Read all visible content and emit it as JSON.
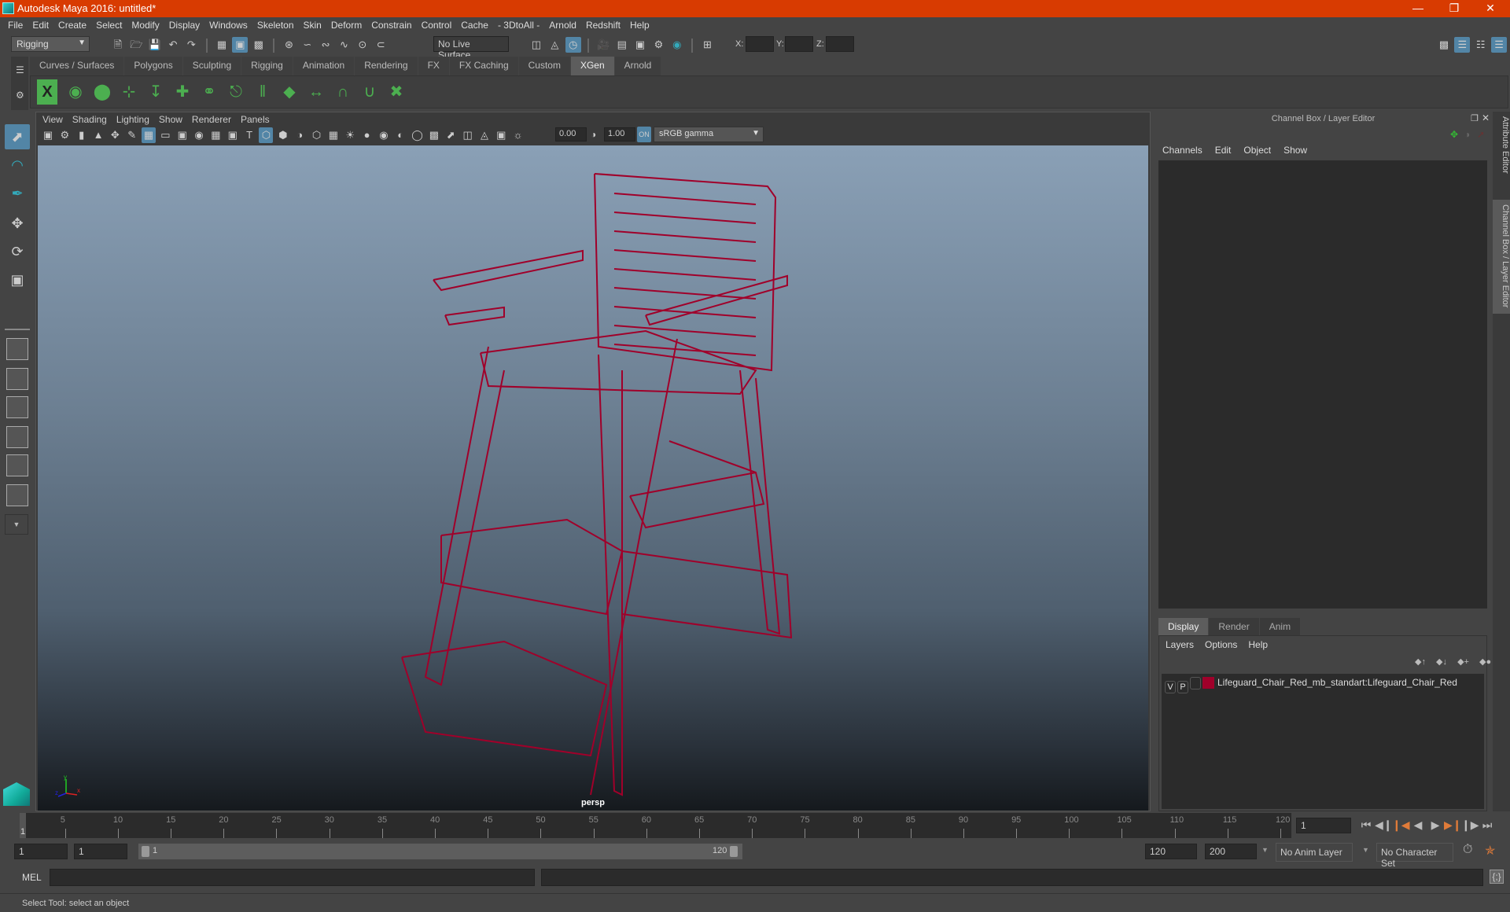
{
  "window": {
    "title": "Autodesk Maya 2016: untitled*",
    "controls": [
      "minimize",
      "restore",
      "close"
    ]
  },
  "menubar": [
    "File",
    "Edit",
    "Create",
    "Select",
    "Modify",
    "Display",
    "Windows",
    "Skeleton",
    "Skin",
    "Deform",
    "Constrain",
    "Control",
    "Cache",
    "- 3DtoAll -",
    "Arnold",
    "Redshift",
    "Help"
  ],
  "statusline": {
    "menuset": "Rigging",
    "live_surface": "No Live Surface",
    "x_label": "X:",
    "y_label": "Y:",
    "z_label": "Z:",
    "x_value": "",
    "y_value": "",
    "z_value": ""
  },
  "shelf": {
    "tabs": [
      "Curves / Surfaces",
      "Polygons",
      "Sculpting",
      "Rigging",
      "Animation",
      "Rendering",
      "FX",
      "FX Caching",
      "Custom",
      "XGen",
      "Arnold"
    ],
    "active_tab": "XGen",
    "icons": [
      "xgen-window-icon",
      "xgen-preview-icon",
      "xgen-clear-preview-icon",
      "add-guides-icon",
      "sculpt-guides-icon",
      "add-guide-icon",
      "select-guide-icon",
      "lock-guide-icon",
      "guides-to-curves-icon",
      "create-collection-icon",
      "flip-guides-icon",
      "rebuild-guide-icon",
      "guide-bounds-icon",
      "delete-guide-icon"
    ]
  },
  "viewport": {
    "menu": [
      "View",
      "Shading",
      "Lighting",
      "Show",
      "Renderer",
      "Panels"
    ],
    "exposure": "0.00",
    "gamma": "1.00",
    "color_space": "sRGB gamma",
    "camera_label": "persp",
    "wire_color": "#a0002a"
  },
  "channel_box": {
    "title": "Channel Box / Layer Editor",
    "menu": [
      "Channels",
      "Edit",
      "Object",
      "Show"
    ]
  },
  "layer_editor": {
    "tabs": [
      "Display",
      "Render",
      "Anim"
    ],
    "active_tab": "Display",
    "menu": [
      "Layers",
      "Options",
      "Help"
    ],
    "layers": [
      {
        "v": "V",
        "p": "P",
        "color": "#a0002a",
        "name": "Lifeguard_Chair_Red_mb_standart:Lifeguard_Chair_Red"
      }
    ]
  },
  "side_tabs": [
    "Attribute Editor",
    "Channel Box / Layer Editor"
  ],
  "timeline": {
    "start": 1,
    "end": 120,
    "ticks": [
      5,
      10,
      15,
      20,
      25,
      30,
      35,
      40,
      45,
      50,
      55,
      60,
      65,
      70,
      75,
      80,
      85,
      90,
      95,
      100,
      105,
      110,
      115,
      120
    ],
    "current_frame_marker": "1",
    "current_frame": "1"
  },
  "range": {
    "start": "1",
    "playback_start": "1",
    "slider_start": "1",
    "slider_end": "120",
    "playback_end": "120",
    "end": "200",
    "anim_layer": "No Anim Layer",
    "character_set": "No Character Set"
  },
  "command_line": {
    "label": "MEL",
    "value": ""
  },
  "help_line": "Select Tool: select an object"
}
